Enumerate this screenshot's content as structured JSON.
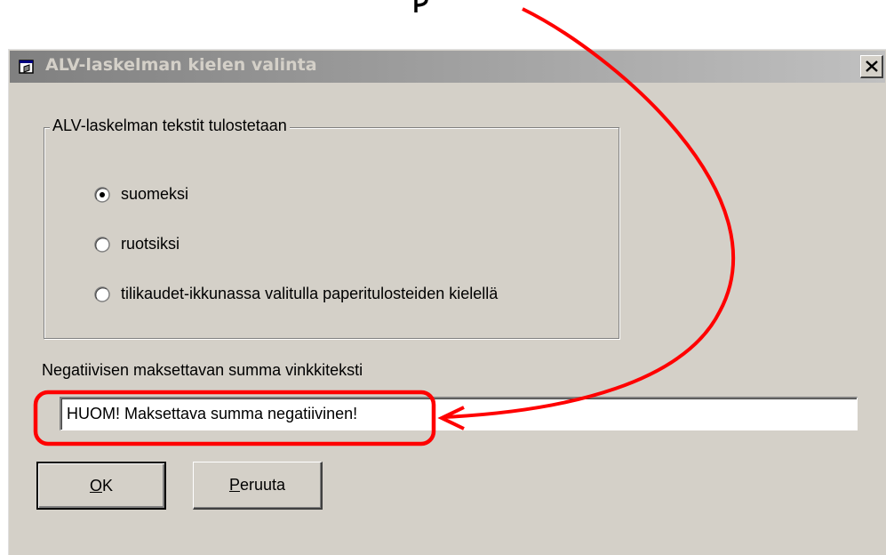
{
  "dialog": {
    "title": "ALV-laskelman kielen valinta",
    "close_glyph": "X",
    "title_icon": "app-window-icon"
  },
  "language_group": {
    "legend": "ALV-laskelman tekstit tulostetaan",
    "options": [
      {
        "label": "suomeksi",
        "selected": true
      },
      {
        "label": "ruotsiksi",
        "selected": false
      },
      {
        "label": "tilikaudet-ikkunassa valitulla paperitulosteiden kielellä",
        "selected": false
      }
    ]
  },
  "hint": {
    "label": "Negatiivisen maksettavan summa vinkkiteksti",
    "value": "HUOM! Maksettava summa negatiivinen!"
  },
  "buttons": {
    "ok": {
      "mnemonic": "O",
      "rest": "K"
    },
    "cancel": {
      "mnemonic": "P",
      "rest": "eruuta"
    }
  },
  "annotation": {
    "color": "#ff0000"
  }
}
